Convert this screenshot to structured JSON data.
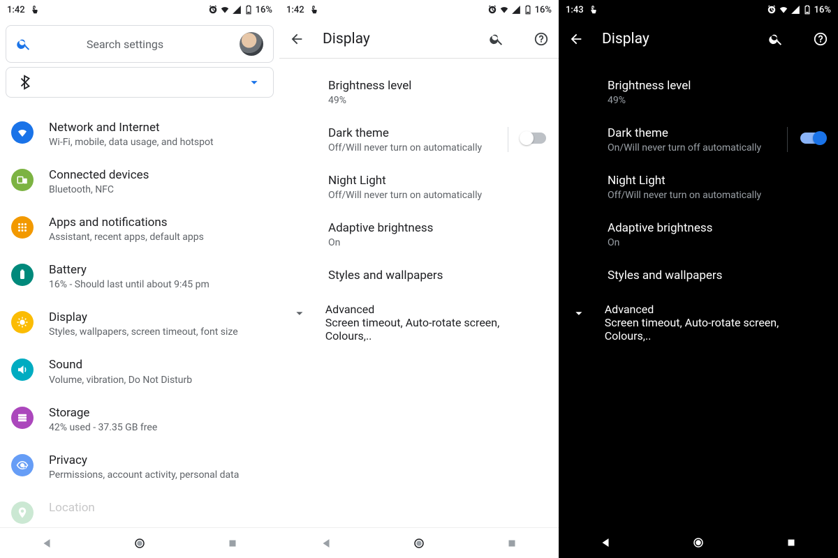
{
  "status": {
    "time_light": "1:42",
    "time_dark": "1:43",
    "battery": "16%"
  },
  "pane1": {
    "search_placeholder": "Search settings",
    "items": [
      {
        "title": "Network and Internet",
        "sub": "Wi-Fi, mobile, data usage, and hotspot",
        "color": "#1a73e8",
        "icon": "wifi"
      },
      {
        "title": "Connected devices",
        "sub": "Bluetooth, NFC",
        "color": "#7cb342",
        "icon": "devices"
      },
      {
        "title": "Apps and notifications",
        "sub": "Assistant, recent apps, default apps",
        "color": "#f29900",
        "icon": "apps"
      },
      {
        "title": "Battery",
        "sub": "16% - Should last until about 9:45 pm",
        "color": "#00897b",
        "icon": "battery"
      },
      {
        "title": "Display",
        "sub": "Styles, wallpapers, screen timeout, font size",
        "color": "#fbbc04",
        "icon": "display"
      },
      {
        "title": "Sound",
        "sub": "Volume, vibration, Do Not Disturb",
        "color": "#00acc1",
        "icon": "sound"
      },
      {
        "title": "Storage",
        "sub": "42% used - 37.35 GB free",
        "color": "#ab47bc",
        "icon": "storage"
      },
      {
        "title": "Privacy",
        "sub": "Permissions, account activity, personal data",
        "color": "#669df6",
        "icon": "privacy"
      },
      {
        "title": "Location",
        "sub": "",
        "color": "#34a853",
        "icon": "location"
      }
    ]
  },
  "display": {
    "heading": "Display",
    "brightness": {
      "title": "Brightness level",
      "value": "49%"
    },
    "dark_theme": {
      "title": "Dark theme",
      "off_sub": "Off/Will never turn on automatically",
      "on_sub": "On/Will never turn off automatically"
    },
    "night_light": {
      "title": "Night Light",
      "sub": "Off/Will never turn on automatically"
    },
    "adaptive": {
      "title": "Adaptive brightness",
      "sub": "On"
    },
    "styles": {
      "title": "Styles and wallpapers"
    },
    "advanced": {
      "title": "Advanced",
      "sub": "Screen timeout, Auto-rotate screen, Colours,.."
    }
  }
}
